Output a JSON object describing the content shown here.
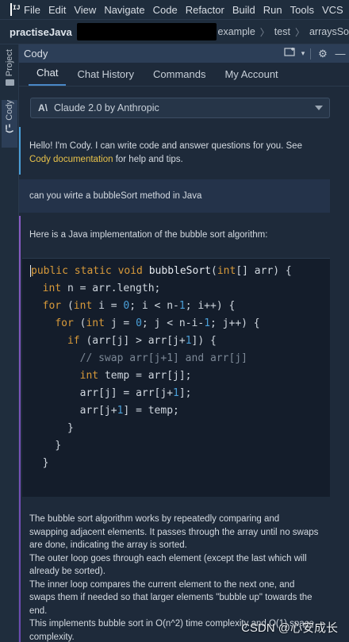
{
  "menu": {
    "logo_text": "IJ",
    "items": [
      "File",
      "Edit",
      "View",
      "Navigate",
      "Code",
      "Refactor",
      "Build",
      "Run",
      "Tools",
      "VCS"
    ]
  },
  "navbar": {
    "project": "practiseJava",
    "breadcrumbs": [
      "example",
      "test",
      "arraysSo"
    ]
  },
  "stripe": {
    "project_label": "Project",
    "cody_label": "Cody"
  },
  "toolwindow": {
    "title": "Cody",
    "new_chat_icon": "new-chat-icon",
    "settings_icon": "gear-icon",
    "minimize_icon": "minimize-icon",
    "tabs": [
      "Chat",
      "Chat History",
      "Commands",
      "My Account"
    ],
    "active_tab": "Chat",
    "model": {
      "logo": "A\\",
      "name": "Claude 2.0 by Anthropic"
    }
  },
  "chat": {
    "greeting_prefix": "Hello! I'm Cody. I can write code and answer questions for you. See",
    "greeting_link": "Cody documentation",
    "greeting_suffix": "for help and tips.",
    "user_message": "can you wirte a bubbleSort method in Java",
    "bot_intro": "Here is a Java implementation of the bubble sort algorithm:",
    "explanation": [
      "The bubble sort algorithm works by repeatedly comparing and swapping adjacent elements. It passes through the array until no swaps are done, indicating the array is sorted.",
      "The outer loop goes through each element (except the last which will already be sorted).",
      "The inner loop compares the current element to the next one, and swaps them if needed so that larger elements \"bubble up\" towards the end.",
      "This implements bubble sort in O(n^2) time complexity and O(1) space complexity."
    ]
  },
  "colors": {
    "accent_bot": "#4a9fd8",
    "accent_bot2": "#8a5cc4",
    "link": "#e8c24a",
    "keyword": "#d89a3a",
    "number": "#4a9fd8"
  },
  "watermark": "CSDN @心安成长"
}
